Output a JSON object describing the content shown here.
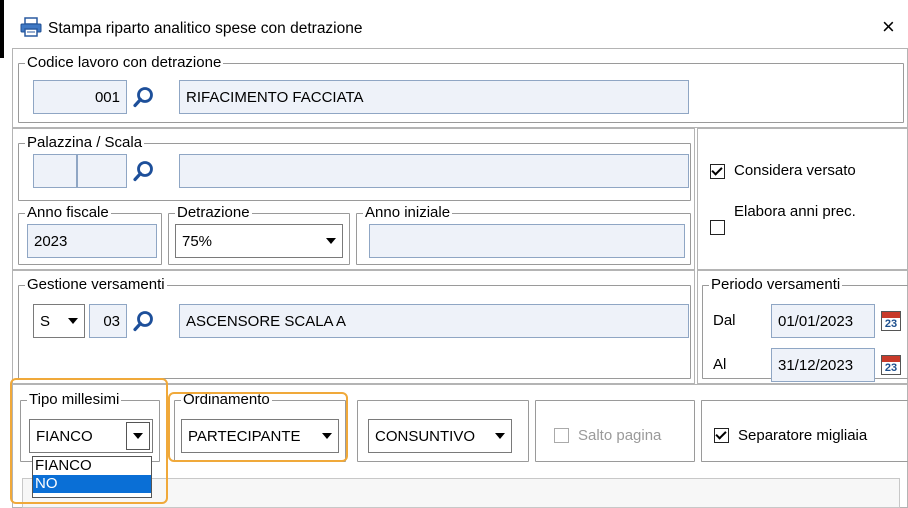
{
  "window": {
    "title": "Stampa riparto analitico spese con detrazione",
    "close_glyph": "×"
  },
  "codice": {
    "legend": "Codice lavoro con detrazione",
    "code": "001",
    "description": "RIFACIMENTO FACCIATA"
  },
  "palazzina": {
    "legend": "Palazzina / Scala",
    "palazzina": "",
    "scala": "",
    "description": ""
  },
  "options": {
    "considera_versato": {
      "label": "Considera versato",
      "checked": true
    },
    "elabora_anni": {
      "label": "Elabora anni prec.",
      "checked": false
    }
  },
  "anno_fiscale": {
    "legend": "Anno fiscale",
    "value": "2023"
  },
  "detrazione": {
    "legend": "Detrazione",
    "value": "75%"
  },
  "anno_iniziale": {
    "legend": "Anno iniziale",
    "value": ""
  },
  "gestione": {
    "legend": "Gestione versamenti",
    "tipo": "S",
    "code": "03",
    "description": "ASCENSORE SCALA A"
  },
  "periodo": {
    "legend": "Periodo versamenti",
    "dal_label": "Dal",
    "dal_value": "01/01/2023",
    "al_label": "Al",
    "al_value": "31/12/2023",
    "cal_day": "23"
  },
  "tipo_millesimi": {
    "legend": "Tipo millesimi",
    "value": "FIANCO",
    "options": [
      "FIANCO",
      "NO"
    ],
    "highlighted": "NO"
  },
  "ordinamento": {
    "legend": "Ordinamento",
    "value": "PARTECIPANTE"
  },
  "tipo_stampa": {
    "value": "CONSUNTIVO"
  },
  "salto_pagina": {
    "label": "Salto pagina",
    "checked": false,
    "enabled": false
  },
  "separatore": {
    "label": "Separatore migliaia",
    "checked": true
  },
  "colors": {
    "accent_highlight": "#f0a93a",
    "selection": "#0a6fd6",
    "field_bg": "#eef2f9"
  },
  "icons": [
    "printer-icon",
    "close-icon",
    "search-icon",
    "calendar-icon",
    "chevron-down-icon",
    "checkbox-icon"
  ]
}
